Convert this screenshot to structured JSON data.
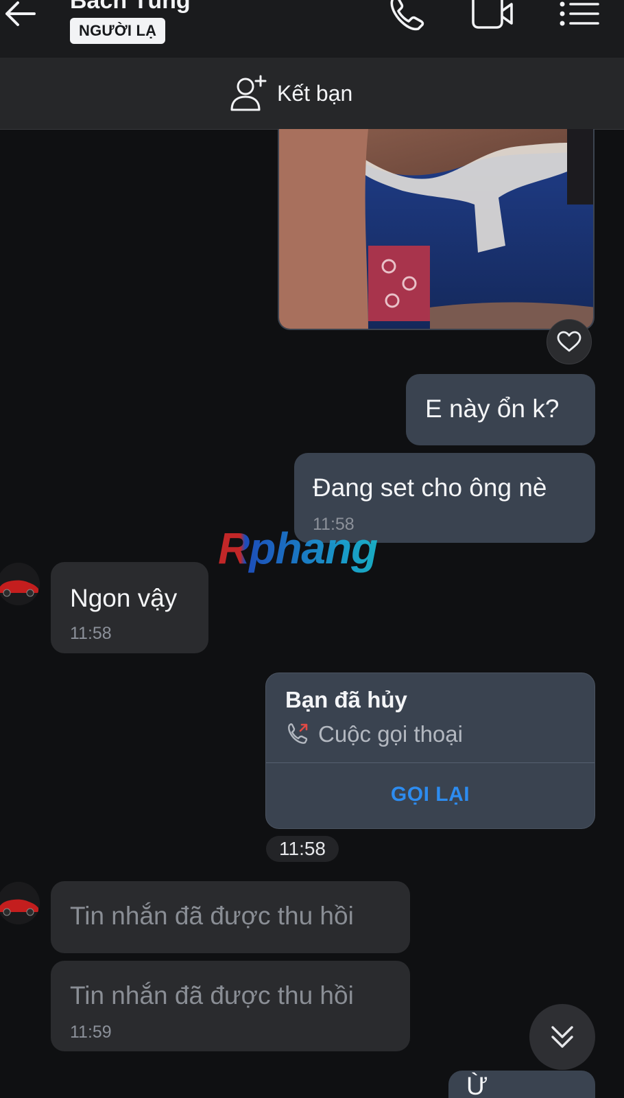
{
  "header": {
    "contact_name": "Bách Tùng",
    "badge": "NGƯỜI LẠ",
    "add_friend_label": "Kết bạn",
    "icons": [
      "back-arrow-icon",
      "phone-icon",
      "video-call-icon",
      "menu-icon"
    ]
  },
  "messages": [
    {
      "type": "photo",
      "direction": "sent",
      "reaction_icon": "heart-icon"
    },
    {
      "type": "text",
      "direction": "sent",
      "text": "E này ổn k?",
      "time": ""
    },
    {
      "type": "text",
      "direction": "sent",
      "text": "Đang set cho ông nè",
      "time": "11:58"
    },
    {
      "type": "text",
      "direction": "received",
      "text": "Ngon vậy",
      "time": "11:58"
    },
    {
      "type": "call",
      "direction": "sent",
      "title": "Bạn đã hủy",
      "subtitle": "Cuộc gọi thoại",
      "action": "GỌI LẠI",
      "time": "11:58"
    },
    {
      "type": "recalled",
      "direction": "received",
      "text": "Tin nhắn đã được thu hồi",
      "time": ""
    },
    {
      "type": "recalled",
      "direction": "received",
      "text": "Tin nhắn đã được thu hồi",
      "time": "11:59"
    },
    {
      "type": "text",
      "direction": "sent",
      "text": "Ừ",
      "time": ""
    }
  ],
  "watermark": "Rphang",
  "colors": {
    "background": "#0f1012",
    "sent_bubble": "#3a4350",
    "received_bubble": "#2a2b2e",
    "link_blue": "#2d8cf0"
  }
}
